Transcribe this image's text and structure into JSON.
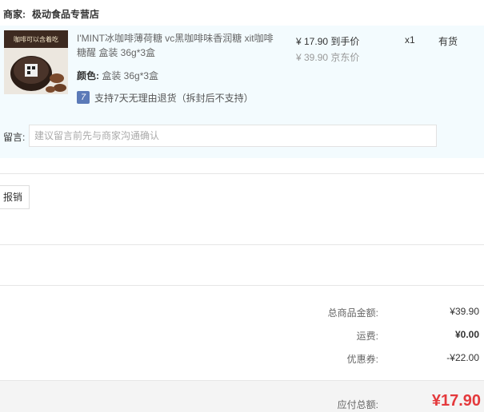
{
  "merchant": {
    "label": "商家:",
    "name": "极动食品专营店"
  },
  "product": {
    "image_text": "咖啡可以含着吃",
    "name": "I'MINT冰咖啡薄荷糖 vc黑咖啡味香润糖 xit咖啡糖醒 盒装 36g*3盒",
    "color_label": "颜色:",
    "color_value": "盒装 36g*3盒",
    "refund_icon": "7",
    "refund_text": "支持7天无理由退货（拆封后不支持）",
    "price_app": "¥ 17.90 到手价",
    "price_jd": "¥ 39.90 京东价",
    "quantity": "x1",
    "stock": "有货"
  },
  "message": {
    "label": "留言:",
    "placeholder": "建议留言前先与商家沟通确认"
  },
  "invoice": {
    "button_label": "报销"
  },
  "summary": {
    "goods_label": "总商品金额:",
    "goods_value": "¥39.90",
    "freight_label": "运费:",
    "freight_value": "¥0.00",
    "coupon_label": "优惠券:",
    "coupon_value": "-¥22.00",
    "total_label": "应付总额:",
    "total_value": "¥17.90"
  },
  "colors": {
    "product_bg": "#f3fbfe",
    "price_red": "#e4393c"
  }
}
